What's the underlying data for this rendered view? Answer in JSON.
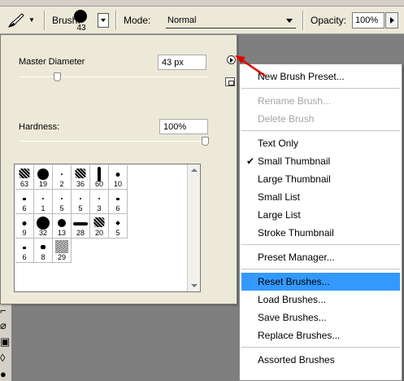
{
  "options_bar": {
    "brush_label": "Brush:",
    "brush_size": "43",
    "mode_label": "Mode:",
    "mode_value": "Normal",
    "opacity_label": "Opacity:",
    "opacity_value": "100%"
  },
  "brush_panel": {
    "master_diameter_label": "Master Diameter",
    "master_diameter_value": "43 px",
    "master_diameter_slider": 0.19,
    "hardness_label": "Hardness:",
    "hardness_value": "100%",
    "hardness_slider": 1.0,
    "presets": [
      {
        "size": "63",
        "shape": "scatter"
      },
      {
        "size": "19",
        "shape": "round-lg"
      },
      {
        "size": "2",
        "shape": "dot-xs"
      },
      {
        "size": "36",
        "shape": "scatter"
      },
      {
        "size": "60",
        "shape": "bar-v"
      },
      {
        "size": "10",
        "shape": "dot-md"
      },
      {
        "size": "6",
        "shape": "leaf"
      },
      {
        "size": "1",
        "shape": "dot-xs"
      },
      {
        "size": "5",
        "shape": "dot-xs"
      },
      {
        "size": "5",
        "shape": "dot-xs"
      },
      {
        "size": "3",
        "shape": "dot-xs"
      },
      {
        "size": "6",
        "shape": "leaf"
      },
      {
        "size": "9",
        "shape": "dot-md"
      },
      {
        "size": "32",
        "shape": "round-xl"
      },
      {
        "size": "13",
        "shape": "round-md"
      },
      {
        "size": "28",
        "shape": "bar-h"
      },
      {
        "size": "20",
        "shape": "scatter"
      },
      {
        "size": "5",
        "shape": "star"
      },
      {
        "size": "6",
        "shape": "leaf"
      },
      {
        "size": "8",
        "shape": "leaf-lg"
      },
      {
        "size": "29",
        "shape": "texture"
      }
    ]
  },
  "menu": {
    "items": [
      {
        "label": "New Brush Preset...",
        "state": "normal"
      },
      {
        "label": "Rename Brush...",
        "state": "disabled"
      },
      {
        "label": "Delete Brush",
        "state": "disabled"
      },
      {
        "label": "Text Only",
        "state": "normal"
      },
      {
        "label": "Small Thumbnail",
        "state": "checked"
      },
      {
        "label": "Large Thumbnail",
        "state": "normal"
      },
      {
        "label": "Small List",
        "state": "normal"
      },
      {
        "label": "Large List",
        "state": "normal"
      },
      {
        "label": "Stroke Thumbnail",
        "state": "normal"
      },
      {
        "label": "Preset Manager...",
        "state": "normal"
      },
      {
        "label": "Reset Brushes...",
        "state": "highlighted"
      },
      {
        "label": "Load Brushes...",
        "state": "normal"
      },
      {
        "label": "Save Brushes...",
        "state": "normal"
      },
      {
        "label": "Replace Brushes...",
        "state": "normal"
      },
      {
        "label": "Assorted Brushes",
        "state": "normal"
      }
    ],
    "check_glyph": "✔"
  },
  "icons": {
    "tool": "brush-tool-icon",
    "flyout": "flyout-menu-icon",
    "new_preset": "new-preset-icon"
  },
  "colors": {
    "highlight": "#3399ff",
    "arrow": "#e00000",
    "disabled": "#a5a5a5"
  }
}
